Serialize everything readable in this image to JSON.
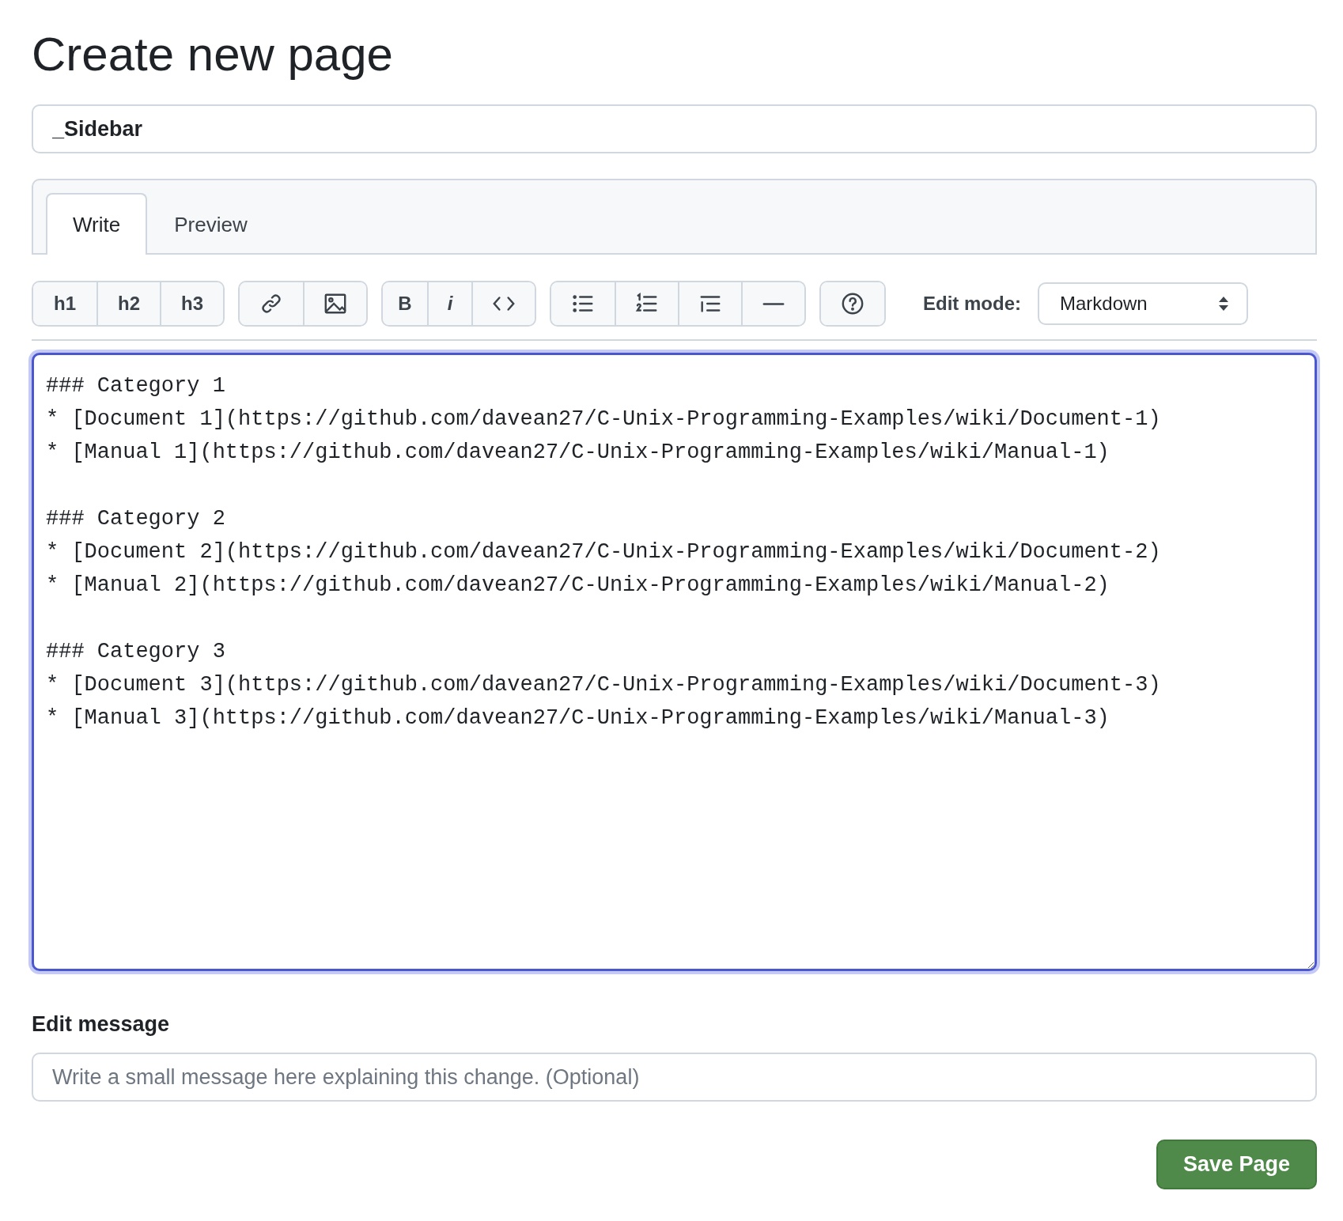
{
  "heading": "Create new page",
  "page_title": {
    "value": "_Sidebar"
  },
  "tabs": [
    {
      "label": "Write",
      "selected": true
    },
    {
      "label": "Preview",
      "selected": false
    }
  ],
  "toolbar": [
    [
      {
        "kind": "text",
        "label": "h1"
      },
      {
        "kind": "text",
        "label": "h2"
      },
      {
        "kind": "text",
        "label": "h3"
      }
    ],
    [
      {
        "kind": "link"
      },
      {
        "kind": "image"
      }
    ],
    [
      {
        "kind": "bold",
        "label": "B"
      },
      {
        "kind": "italic",
        "label": "i"
      },
      {
        "kind": "code"
      }
    ],
    [
      {
        "kind": "bullet-list"
      },
      {
        "kind": "numbered-list"
      },
      {
        "kind": "quote"
      },
      {
        "kind": "rule"
      }
    ],
    [
      {
        "kind": "help"
      }
    ]
  ],
  "edit_mode": {
    "label": "Edit mode:",
    "value": "Markdown"
  },
  "editor": {
    "value": "### Category 1\n* [Document 1](https://github.com/davean27/C-Unix-Programming-Examples/wiki/Document-1)\n* [Manual 1](https://github.com/davean27/C-Unix-Programming-Examples/wiki/Manual-1)\n\n### Category 2\n* [Document 2](https://github.com/davean27/C-Unix-Programming-Examples/wiki/Document-2)\n* [Manual 2](https://github.com/davean27/C-Unix-Programming-Examples/wiki/Manual-2)\n\n### Category 3\n* [Document 3](https://github.com/davean27/C-Unix-Programming-Examples/wiki/Document-3)\n* [Manual 3](https://github.com/davean27/C-Unix-Programming-Examples/wiki/Manual-3)"
  },
  "edit_message": {
    "label": "Edit message",
    "placeholder": "Write a small message here explaining this change. (Optional)"
  },
  "save_button": "Save Page"
}
